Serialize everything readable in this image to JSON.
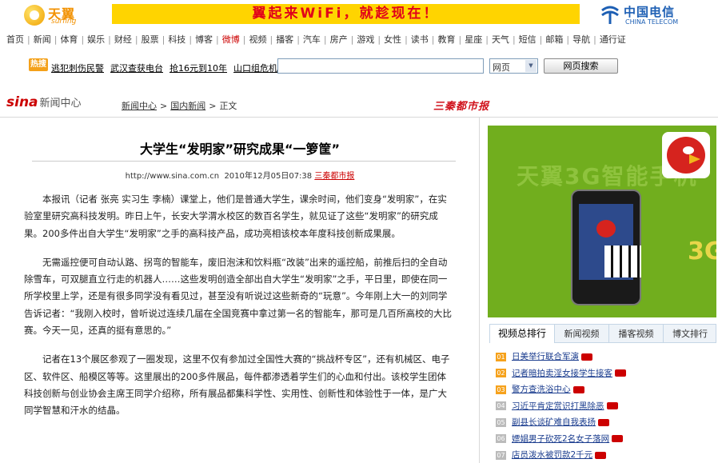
{
  "topbar": {
    "tianyi_logo": "天翼",
    "tianyi_sub": "surfing",
    "wifi_banner": "翼起来WiFi，就趁现在！",
    "telecom_cn": "中国电信",
    "telecom_en": "CHINA TELECOM"
  },
  "channels": [
    "首页",
    "新闻",
    "体育",
    "娱乐",
    "财经",
    "股票",
    "科技",
    "博客",
    "微博",
    "视频",
    "播客",
    "汽车",
    "房产",
    "游戏",
    "女性",
    "读书",
    "教育",
    "星座",
    "天气",
    "短信",
    "邮箱",
    "导航",
    "通行证"
  ],
  "hot": {
    "label": "热搜",
    "links": [
      "逃犯刺伤民警",
      "武汉查获电台",
      "抢16元到10年",
      "山口组危机"
    ]
  },
  "search": {
    "query": "",
    "select_value": "网页",
    "button": "网页搜索"
  },
  "header": {
    "sina_logo": "sina",
    "sina_name": "新闻中心",
    "breadcrumb": [
      "新闻中心",
      "国内新闻",
      "正文"
    ],
    "partner_logo": "三秦都市报"
  },
  "article": {
    "title": "大学生“发明家”研究成果“一箩筐”",
    "url": "http://www.sina.com.cn",
    "date": "2010年12月05日07:38",
    "source": "三秦都市报",
    "paragraphs": [
      "本报讯（记者 张亮 实习生 李楠）课堂上，他们是普通大学生，课余时间，他们变身“发明家”，在实验室里研究高科技发明。昨日上午，长安大学渭水校区的数百名学生，就见证了这些“发明家”的研究成果。200多件出自大学生“发明家”之手的高科技产品，成功亮相该校本年度科技创新成果展。",
      "无需遥控便可自动认路、拐弯的智能车，废旧泡沫和饮料瓶“改装”出来的遥控船，前推后扫的全自动除雪车，可双腿直立行走的机器人……这些发明创造全部出自大学生“发明家”之手，平日里，即使在同一所学校里上学，还是有很多同学没有看见过，甚至没有听说过这些新奇的“玩意”。今年刚上大一的刘同学告诉记者：“我刚入校时，曾听说过连续几届在全国竞赛中拿过第一名的智能车，那可是几百所高校的大比赛。今天一见，还真的挺有意思的。”",
      "记者在13个展区参观了一圈发现，这里不仅有参加过全国性大赛的“挑战杯专区”，还有机械区、电子区、软件区、船模区等等。这里展出的200多件展品，每件都渗透着学生们的心血和付出。该校学生团体科技创新与创业协会主席王同学介绍称，所有展品都集科学性、实用性、创新性和体验性于一体，是广大同学智慧和汗水的结晶。"
    ]
  },
  "ad": {
    "watermark": "天翼3G智能手机",
    "number": "3G"
  },
  "video": {
    "tabs": [
      "视频总排行",
      "新闻视频",
      "播客视频",
      "博文排行"
    ],
    "items": [
      {
        "rank": "01",
        "title": "日美举行联合军演"
      },
      {
        "rank": "02",
        "title": "记者暗拍卖淫女接学生接客"
      },
      {
        "rank": "03",
        "title": "警方查洗浴中心"
      },
      {
        "rank": "04",
        "title": "习近平肯定赏识打黑除恶"
      },
      {
        "rank": "05",
        "title": "副县长谈矿难自我表扬"
      },
      {
        "rank": "06",
        "title": "嫖娼男子砍死2名女子落网"
      },
      {
        "rank": "07",
        "title": "店员泼水被罚款2千元"
      }
    ]
  }
}
